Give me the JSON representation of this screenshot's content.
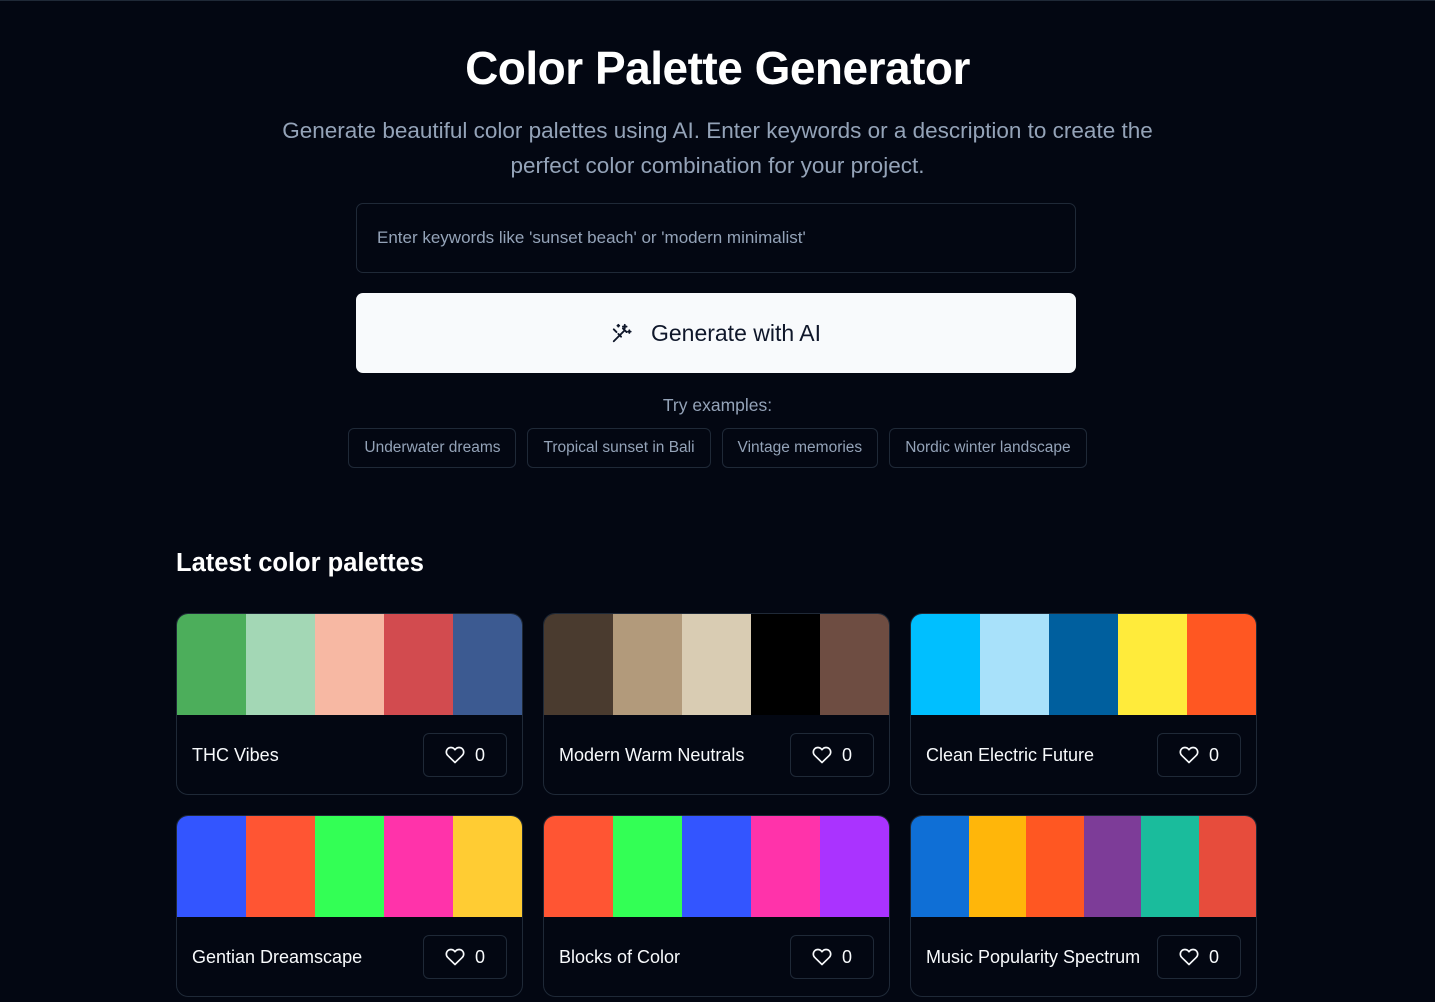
{
  "header": {
    "title": "Color Palette Generator",
    "subtitle": "Generate beautiful color palettes using AI. Enter keywords or a description to create the perfect color combination for your project."
  },
  "search": {
    "placeholder": "Enter keywords like 'sunset beach' or 'modern minimalist'",
    "value": ""
  },
  "generate": {
    "label": "Generate with AI",
    "icon": "magic-wand-icon"
  },
  "examples": {
    "label": "Try examples:",
    "items": [
      "Underwater dreams",
      "Tropical sunset in Bali",
      "Vintage memories",
      "Nordic winter landscape"
    ]
  },
  "latest": {
    "title": "Latest color palettes",
    "palettes": [
      {
        "name": "THC Vibes",
        "likes": "0",
        "colors": [
          "#4cae5b",
          "#a3d7b5",
          "#f7b8a3",
          "#d24b4f",
          "#3c5a91"
        ]
      },
      {
        "name": "Modern Warm Neutrals",
        "likes": "0",
        "colors": [
          "#4a3b2f",
          "#b29a7b",
          "#d9ccb3",
          "#000000",
          "#6e4d42"
        ]
      },
      {
        "name": "Clean Electric Future",
        "likes": "0",
        "colors": [
          "#00bfff",
          "#a8e1fa",
          "#005f9e",
          "#ffeb3b",
          "#ff5722"
        ]
      },
      {
        "name": "Gentian Dreamscape",
        "likes": "0",
        "colors": [
          "#3355ff",
          "#ff5533",
          "#33ff55",
          "#ff33aa",
          "#ffcc33"
        ]
      },
      {
        "name": "Blocks of Color",
        "likes": "0",
        "colors": [
          "#ff5533",
          "#33ff55",
          "#3355ff",
          "#ff33aa",
          "#aa33ff"
        ]
      },
      {
        "name": "Music Popularity Spectrum",
        "likes": "0",
        "colors": [
          "#0f6fd6",
          "#ffb60a",
          "#ff5722",
          "#7d3c98",
          "#1abc9c",
          "#e74c3c"
        ]
      }
    ]
  },
  "colors": {
    "background": "#030712",
    "border": "#1f2937",
    "muted_text": "#94a3b8",
    "button_bg": "#f8fafc"
  }
}
